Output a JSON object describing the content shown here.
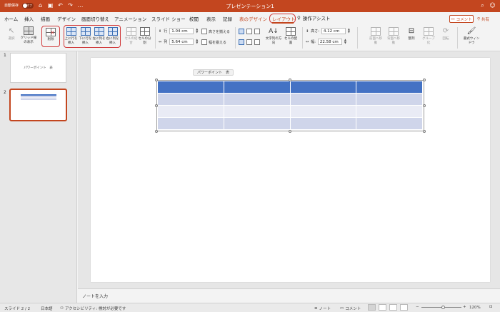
{
  "titlebar": {
    "autosave_label": "自動保存",
    "autosave_state": "オフ",
    "document_title": "プレゼンテーション1",
    "undo_glyph": "↶",
    "redo_glyph": "↷",
    "more_glyph": "…"
  },
  "tabs": [
    {
      "label": "ホーム"
    },
    {
      "label": "挿入"
    },
    {
      "label": "描画"
    },
    {
      "label": "デザイン"
    },
    {
      "label": "画面切り替え"
    },
    {
      "label": "アニメーション"
    },
    {
      "label": "スライド ショー"
    },
    {
      "label": "校閲"
    },
    {
      "label": "表示"
    },
    {
      "label": "記録"
    },
    {
      "label": "表のデザイン"
    },
    {
      "label": "レイアウト"
    }
  ],
  "tell_me": "操作アシスト",
  "comment_button": "コメント",
  "share_button": "共有",
  "ribbon": {
    "select": "選択",
    "gridlines": "グリッド線の表示",
    "delete": "削除",
    "insert_above": "上に行を挿入",
    "insert_below": "下に行を挿入",
    "insert_left": "左に列を挿入",
    "insert_right": "右に列を挿入",
    "merge_cells": "セルの結合",
    "split_cells": "セルの分割",
    "row_height_value": "1.04 cm",
    "col_width_value": "5.64 cm",
    "row_label": "行",
    "col_label": "列",
    "distribute_rows": "高さを揃える",
    "distribute_cols": "幅を揃える",
    "text_direction": "文字列の方向",
    "cell_margins": "セルの配置",
    "height_label": "高さ:",
    "height_value": "4.12 cm",
    "width_label": "幅:",
    "width_value": "22.58 cm",
    "bring_forward": "前面へ移動",
    "send_backward": "背面へ移動",
    "align": "整列",
    "group": "グループ化",
    "rotate": "回転",
    "format_pane": "書式ウィンドウ"
  },
  "thumbnails": [
    {
      "number": "1",
      "text": "パワーポイント　表"
    },
    {
      "number": "2",
      "text": ""
    }
  ],
  "slide": {
    "tooltip": "パワーポイント　表",
    "table": {
      "rows": 4,
      "cols": 4
    }
  },
  "notes_placeholder": "ノートを入力",
  "status": {
    "slide_counter": "スライド 2 / 2",
    "language": "日本語",
    "accessibility": "アクセシビリティ: 検討が必要です",
    "notes": "ノート",
    "comments": "コメント",
    "zoom": "120%"
  },
  "colors": {
    "accent": "#c3461f",
    "table_header": "#4472c4",
    "table_band1": "#cfd5ea",
    "table_band2": "#e9ebf5",
    "highlight": "#d0393a"
  }
}
